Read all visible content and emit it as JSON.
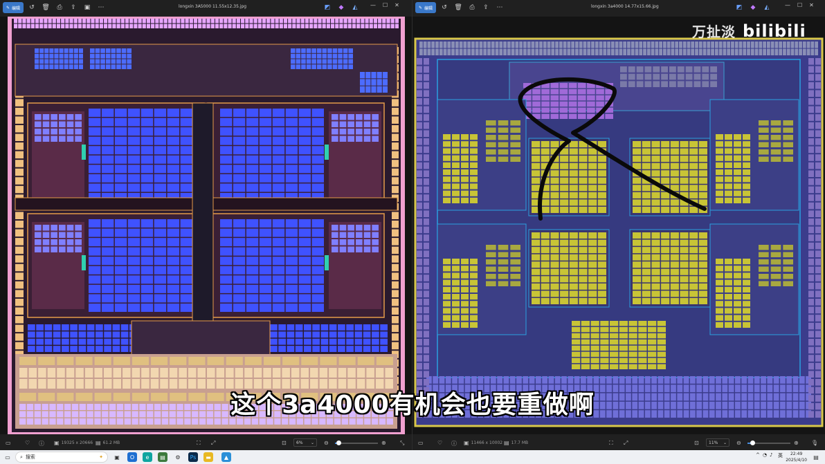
{
  "left_window": {
    "edit_label": "编辑",
    "title": "longxin 3A5000 11.55x12.35.jpg",
    "dimensions": "19325 x 20666",
    "file_size": "61.2 MB",
    "zoom": "6%",
    "zoom_fraction": 0.06
  },
  "right_window": {
    "edit_label": "编辑",
    "title": "longxin  3a4000 14.77x15.66.jpg",
    "dimensions": "11466 x 10002",
    "file_size": "17.7 MB",
    "zoom": "11%",
    "zoom_fraction": 0.11
  },
  "toolbar_icons": [
    "rotate-icon",
    "delete-icon",
    "print-icon",
    "share-icon",
    "slideshow-icon",
    "more-icon"
  ],
  "overlay": {
    "subtitle": "这个3a4000有机会也要重做啊",
    "watermark_text": "万扯淡",
    "watermark_logo": "bilibili"
  },
  "taskbar": {
    "search_placeholder": "搜索",
    "input_method": "英",
    "time": "22:49",
    "date": "2025/4/10"
  },
  "colors": {
    "accent": "#3a78c9",
    "left_die_border": "#f0a0d0",
    "left_core_block": "#3f52ff",
    "right_die_bg": "#3b3c8c",
    "right_core_block": "#c8c436",
    "annotation_stroke": "#0a0a0a"
  }
}
